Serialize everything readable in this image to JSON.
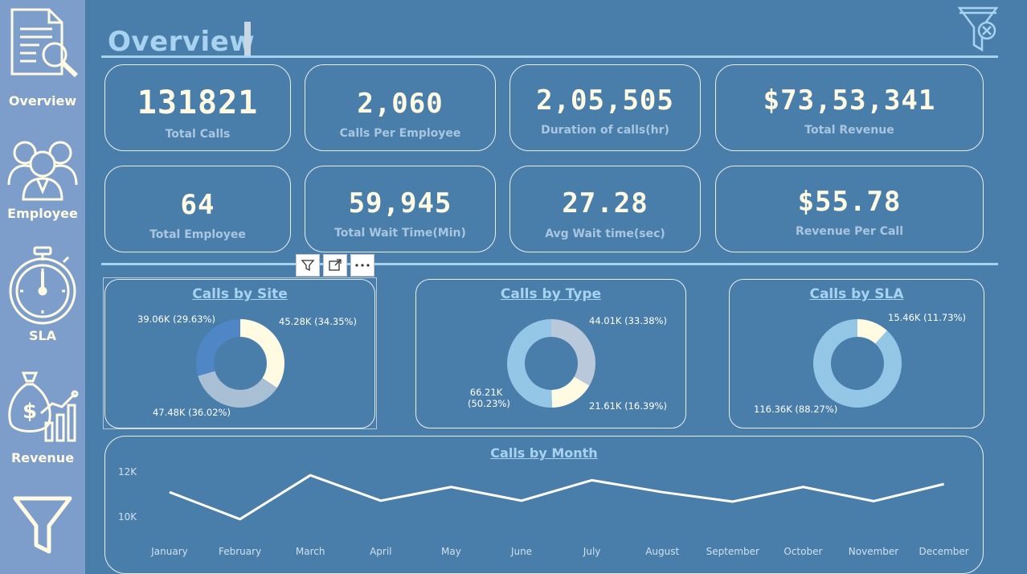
{
  "nav": {
    "items": [
      {
        "label": "Overview",
        "icon": "document-magnifier-icon"
      },
      {
        "label": "Employee",
        "icon": "people-group-icon"
      },
      {
        "label": "SLA",
        "icon": "stopwatch-icon"
      },
      {
        "label": "Revenue",
        "icon": "money-bag-chart-icon"
      },
      {
        "label": "",
        "icon": "filter-funnel-icon"
      }
    ]
  },
  "page": {
    "title": "Overview"
  },
  "kpis": [
    {
      "value": "131821",
      "label": "Total Calls"
    },
    {
      "value": "2,060",
      "label": "Calls Per Employee"
    },
    {
      "value": "2,05,505",
      "label": "Duration of calls(hr)"
    },
    {
      "value": "$73,53,341",
      "label": "Total Revenue"
    },
    {
      "value": "64",
      "label": "Total Employee"
    },
    {
      "value": "59,945",
      "label": "Total Wait Time(Min)"
    },
    {
      "value": "27.28",
      "label": "Avg Wait time(sec)"
    },
    {
      "value": "$55.78",
      "label": "Revenue Per Call"
    }
  ],
  "colors": {
    "background": "#4a7eaa",
    "sidebar": "#7d9ecb",
    "accent": "#a7d3f0",
    "cream": "#fffbe3"
  },
  "chart_data": [
    {
      "type": "pie",
      "title": "Calls by Site",
      "slices": [
        {
          "value": 45.28,
          "label": "45.28K (34.35%)",
          "color": "#fffbe3"
        },
        {
          "value": 47.48,
          "label": "47.48K (36.02%)",
          "color": "#a9bfd3"
        },
        {
          "value": 39.06,
          "label": "39.06K (29.63%)",
          "color": "#4f86c6"
        }
      ]
    },
    {
      "type": "pie",
      "title": "Calls by Type",
      "slices": [
        {
          "value": 44.01,
          "label": "44.01K (33.38%)",
          "color": "#b9c8da"
        },
        {
          "value": 21.61,
          "label": "21.61K (16.39%)",
          "color": "#fffbe3"
        },
        {
          "value": 66.21,
          "label": "66.21K (50.23%)",
          "color": "#94c6e6"
        }
      ]
    },
    {
      "type": "pie",
      "title": "Calls by SLA",
      "slices": [
        {
          "value": 15.46,
          "label": "15.46K (11.73%)",
          "color": "#fffbe3"
        },
        {
          "value": 116.36,
          "label": "116.36K (88.27%)",
          "color": "#94c6e6"
        }
      ]
    },
    {
      "type": "line",
      "title": "Calls by Month",
      "categories": [
        "January",
        "February",
        "March",
        "April",
        "May",
        "June",
        "July",
        "August",
        "September",
        "October",
        "November",
        "December"
      ],
      "values": [
        11100,
        9900,
        11850,
        10720,
        11330,
        10720,
        11630,
        11100,
        10680,
        11330,
        10700,
        11460
      ],
      "yticks": [
        "12K",
        "10K"
      ],
      "ylim": [
        9500,
        13000
      ]
    }
  ]
}
